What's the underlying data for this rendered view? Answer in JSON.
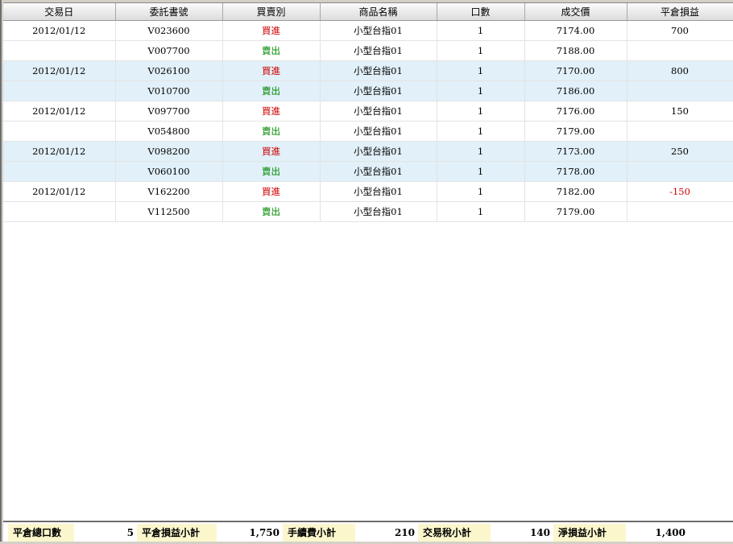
{
  "table": {
    "columns": [
      "交易日",
      "委託書號",
      "買賣別",
      "商品名稱",
      "口數",
      "成交價",
      "平倉損益"
    ],
    "rows": [
      {
        "date": "2012/01/12",
        "order": "V023600",
        "side": "買進",
        "side_type": "buy",
        "product": "小型台指01",
        "qty": "1",
        "price": "7174.00",
        "pnl": "700",
        "pnl_type": "pos"
      },
      {
        "date": "",
        "order": "V007700",
        "side": "賣出",
        "side_type": "sell",
        "product": "小型台指01",
        "qty": "1",
        "price": "7188.00",
        "pnl": "",
        "pnl_type": "pos"
      },
      {
        "date": "2012/01/12",
        "order": "V026100",
        "side": "買進",
        "side_type": "buy",
        "product": "小型台指01",
        "qty": "1",
        "price": "7170.00",
        "pnl": "800",
        "pnl_type": "pos"
      },
      {
        "date": "",
        "order": "V010700",
        "side": "賣出",
        "side_type": "sell",
        "product": "小型台指01",
        "qty": "1",
        "price": "7186.00",
        "pnl": "",
        "pnl_type": "pos"
      },
      {
        "date": "2012/01/12",
        "order": "V097700",
        "side": "買進",
        "side_type": "buy",
        "product": "小型台指01",
        "qty": "1",
        "price": "7176.00",
        "pnl": "150",
        "pnl_type": "pos"
      },
      {
        "date": "",
        "order": "V054800",
        "side": "賣出",
        "side_type": "sell",
        "product": "小型台指01",
        "qty": "1",
        "price": "7179.00",
        "pnl": "",
        "pnl_type": "pos"
      },
      {
        "date": "2012/01/12",
        "order": "V098200",
        "side": "買進",
        "side_type": "buy",
        "product": "小型台指01",
        "qty": "1",
        "price": "7173.00",
        "pnl": "250",
        "pnl_type": "pos"
      },
      {
        "date": "",
        "order": "V060100",
        "side": "賣出",
        "side_type": "sell",
        "product": "小型台指01",
        "qty": "1",
        "price": "7178.00",
        "pnl": "",
        "pnl_type": "pos"
      },
      {
        "date": "2012/01/12",
        "order": "V162200",
        "side": "買進",
        "side_type": "buy",
        "product": "小型台指01",
        "qty": "1",
        "price": "7182.00",
        "pnl": "-150",
        "pnl_type": "neg"
      },
      {
        "date": "",
        "order": "V112500",
        "side": "賣出",
        "side_type": "sell",
        "product": "小型台指01",
        "qty": "1",
        "price": "7179.00",
        "pnl": "",
        "pnl_type": "pos"
      }
    ]
  },
  "summary": {
    "closed_lots_label": "平倉總口數",
    "closed_lots_value": "5",
    "pnl_subtotal_label": "平倉損益小計",
    "pnl_subtotal_value": "1,750",
    "fee_subtotal_label": "手續費小計",
    "fee_subtotal_value": "210",
    "tax_subtotal_label": "交易稅小計",
    "tax_subtotal_value": "140",
    "net_pnl_label": "淨損益小計",
    "net_pnl_value": "1,400"
  },
  "colors": {
    "buy": "#cc0000",
    "sell": "#008800",
    "row_alt": "#e1f0f9",
    "summary_label_bg": "#fcf6cd"
  }
}
